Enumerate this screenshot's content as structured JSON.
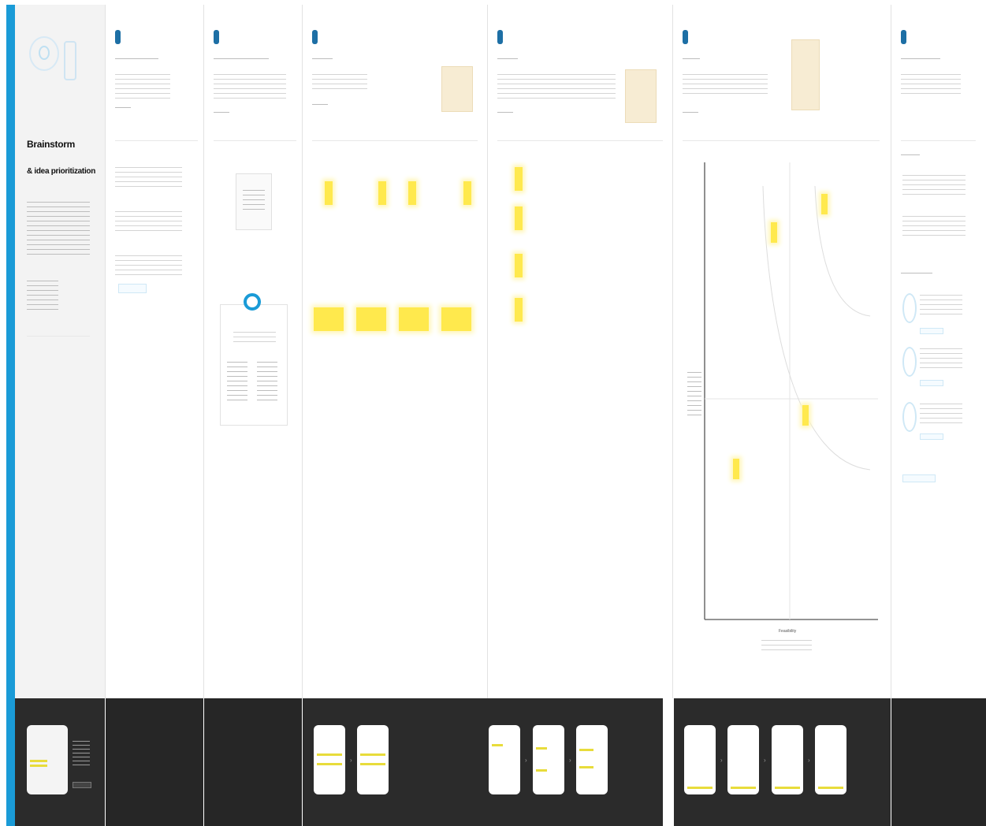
{
  "intro": {
    "title_line1": "Brainstorm",
    "title_line2": "& idea prioritization"
  },
  "axis": {
    "x_label": "Feasibility"
  },
  "colors": {
    "accent": "#1a9bd7",
    "sticky": "#ffe94d",
    "dark_strip": "#2b2b2b"
  },
  "icons": [
    "target-icon",
    "add-icon",
    "arrow-icon"
  ]
}
